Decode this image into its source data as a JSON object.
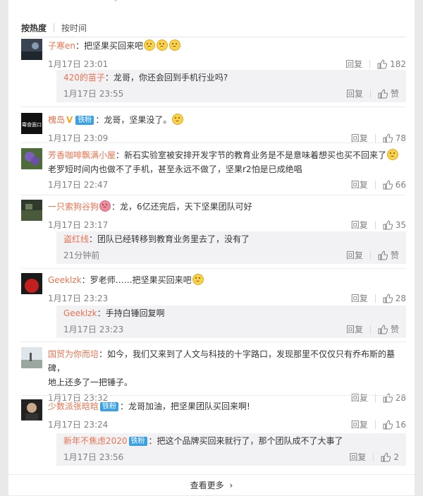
{
  "tabs": {
    "hot": "按热度",
    "time": "按时间"
  },
  "common": {
    "reply": "回复",
    "like": "赞"
  },
  "comments": [
    {
      "user": "子寒en",
      "text": "：把坚果买回来吧",
      "time": "1月17日 23:01",
      "likes": "182",
      "reply": {
        "user": "420的苗子",
        "text": "：龙哥，你还会回到手机行业吗?",
        "time": "1月17日 23:55",
        "likes": "赞"
      }
    },
    {
      "user": "槐岛",
      "badge": "铁粉",
      "text": "：龙哥，坚果没了。",
      "time": "1月17日 23:09",
      "likes": "78"
    },
    {
      "user": "芳香咖啡飘满小屋",
      "text": "：新石实验室被安排开发字节的教育业务是不是意味着想买也买不回来了",
      "text2": "老罗短时间内也做不了手机，甚至永远不做了，坚果r2怕是已成绝唱",
      "time": "1月17日 22:47",
      "likes": "66"
    },
    {
      "user": "一只索狗谷狗",
      "text": "：龙，6亿还完后，天下坚果团队可好",
      "time": "1月17日 23:17",
      "likes": "35",
      "reply": {
        "user": "盗红线",
        "text": "：团队已经转移到教育业务里去了，没有了",
        "time": "21分钟前",
        "likes": "赞"
      }
    },
    {
      "user": "Geeklzk",
      "text": "：罗老师……把坚果买回来吧",
      "time": "1月17日 23:23",
      "likes": "28",
      "reply": {
        "user": "Geeklzk",
        "text": "：手持白锤回复啊",
        "time": "1月17日 23:23",
        "likes": "赞"
      }
    },
    {
      "user": "国贸为你而培",
      "text": "：如今，我们又来到了人文与科技的十字路口，发现那里不仅仅只有乔布斯的墓碑，",
      "text2": "地上还多了一把锤子。",
      "time": "1月17日 23:32",
      "likes": "28"
    },
    {
      "user": "少数派张晗晗",
      "badge": "铁粉",
      "text": "：龙哥加油，把坚果团队买回来啊!",
      "time": "1月17日 23:24",
      "likes": "16",
      "reply": {
        "user": "新年不焦虑2020",
        "badge": "铁粉",
        "text": "：把这个品牌买回来就行了，那个团队成不了大事了",
        "time": "1月17日 23:56",
        "likes": "2"
      }
    }
  ],
  "avatar_labels": {
    "c2": "霉食面口"
  },
  "more": "查看更多"
}
